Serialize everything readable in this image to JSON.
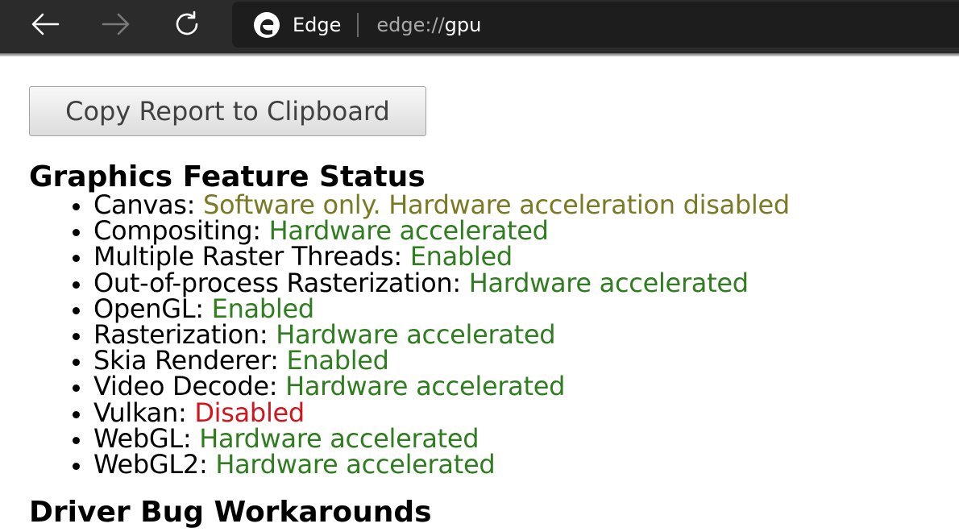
{
  "browser": {
    "site_name": "Edge",
    "url_scheme": "edge://",
    "url_host": "gpu"
  },
  "page": {
    "copy_button_label": "Copy Report to Clipboard",
    "section_title": "Graphics Feature Status",
    "next_section_title": "Driver Bug Workarounds"
  },
  "features": [
    {
      "name": "Canvas",
      "status": "Software only. Hardware acceleration disabled",
      "state": "software"
    },
    {
      "name": "Compositing",
      "status": "Hardware accelerated",
      "state": "enabled"
    },
    {
      "name": "Multiple Raster Threads",
      "status": "Enabled",
      "state": "enabled"
    },
    {
      "name": "Out-of-process Rasterization",
      "status": "Hardware accelerated",
      "state": "enabled"
    },
    {
      "name": "OpenGL",
      "status": "Enabled",
      "state": "enabled"
    },
    {
      "name": "Rasterization",
      "status": "Hardware accelerated",
      "state": "enabled"
    },
    {
      "name": "Skia Renderer",
      "status": "Enabled",
      "state": "enabled"
    },
    {
      "name": "Video Decode",
      "status": "Hardware accelerated",
      "state": "enabled"
    },
    {
      "name": "Vulkan",
      "status": "Disabled",
      "state": "disabled"
    },
    {
      "name": "WebGL",
      "status": "Hardware accelerated",
      "state": "enabled"
    },
    {
      "name": "WebGL2",
      "status": "Hardware accelerated",
      "state": "enabled"
    }
  ],
  "colors": {
    "enabled": "#2e7d1e",
    "software": "#7a7a24",
    "disabled": "#d2151d"
  },
  "icons": {
    "back": "back-arrow-icon",
    "forward": "forward-arrow-icon",
    "refresh": "refresh-icon",
    "logo": "edge-logo-icon"
  }
}
